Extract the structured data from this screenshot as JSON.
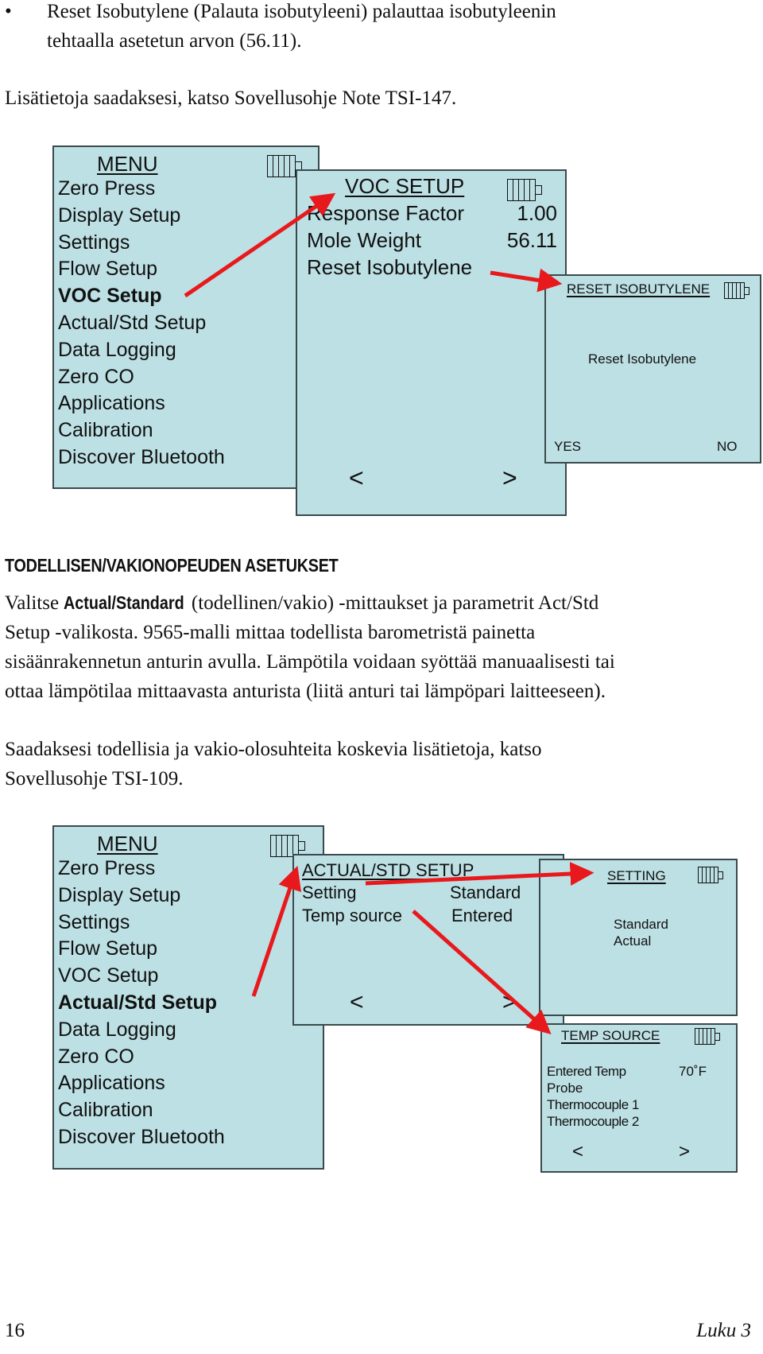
{
  "intro": {
    "bullet": "•",
    "bullet_line1": "Reset Isobutylene (Palauta isobutyleeni) palauttaa isobutyleenin",
    "bullet_line2": "tehtaalla asetetun arvon (56.11).",
    "more_info": "Lisätietoja saadaksesi, katso Sovellusohje Note TSI-147."
  },
  "diagram1": {
    "menu": {
      "title": "MENU",
      "items": [
        "Zero Press",
        "Display Setup",
        "Settings",
        "Flow Setup",
        "VOC Setup",
        "Actual/Std Setup",
        "Data Logging",
        "Zero CO",
        "Applications",
        "Calibration",
        "Discover Bluetooth"
      ],
      "selected": "VOC Setup"
    },
    "voc_setup": {
      "title": "VOC SETUP",
      "rows": [
        {
          "label": "Response Factor",
          "value": "1.00"
        },
        {
          "label": "Mole Weight",
          "value": "56.11"
        },
        {
          "label": "Reset Isobutylene",
          "value": ""
        }
      ],
      "nav_prev": "<",
      "nav_next": ">"
    },
    "reset_isobutylene": {
      "title": "RESET ISOBUTYLENE",
      "message": "Reset Isobutylene",
      "yes": "YES",
      "no": "NO"
    }
  },
  "section": {
    "heading": "TODELLISEN/VAKIONOPEUDEN ASETUKSET",
    "p1_pre": "Valitse ",
    "p1_bold": "Actual/Standard",
    "p1_line1_post": " (todellinen/vakio) -mittaukset ja parametrit Act/Std",
    "p1_line2": "Setup -valikosta. 9565-malli mittaa todellista barometristä painetta",
    "p1_line3": "sisäänrakennetun anturin avulla. Lämpötila voidaan syöttää manuaalisesti tai",
    "p1_line4": "ottaa lämpötilaa mittaavasta anturista (liitä anturi tai lämpöpari laitteeseen).",
    "p2_line1": "Saadaksesi todellisia ja vakio-olosuhteita koskevia lisätietoja, katso",
    "p2_line2": "Sovellusohje TSI-109."
  },
  "diagram2": {
    "menu": {
      "title": "MENU",
      "items": [
        "Zero Press",
        "Display Setup",
        "Settings",
        "Flow Setup",
        "VOC Setup",
        "Actual/Std Setup",
        "Data Logging",
        "Zero CO",
        "Applications",
        "Calibration",
        "Discover Bluetooth"
      ],
      "selected": "Actual/Std Setup"
    },
    "actual_std_setup": {
      "title": "ACTUAL/STD SETUP",
      "rows": [
        {
          "label": "Setting",
          "value": "Standard"
        },
        {
          "label": "Temp source",
          "value": "Entered"
        }
      ],
      "nav_prev": "<",
      "nav_next": ">"
    },
    "setting": {
      "title": "SETTING",
      "options": [
        "Standard",
        "Actual"
      ]
    },
    "temp_source": {
      "title": "TEMP SOURCE",
      "options": [
        {
          "label": "Entered Temp",
          "value": "70˚F"
        },
        {
          "label": "Probe",
          "value": ""
        },
        {
          "label": "Thermocouple 1",
          "value": ""
        },
        {
          "label": "Thermocouple 2",
          "value": ""
        }
      ],
      "nav_prev": "<",
      "nav_next": ">"
    }
  },
  "footer": {
    "page_number": "16",
    "chapter": "Luku 3"
  },
  "colors": {
    "lcd_background": "#bde0e4",
    "arrow": "#e8191c",
    "border": "#3a4a4c"
  }
}
